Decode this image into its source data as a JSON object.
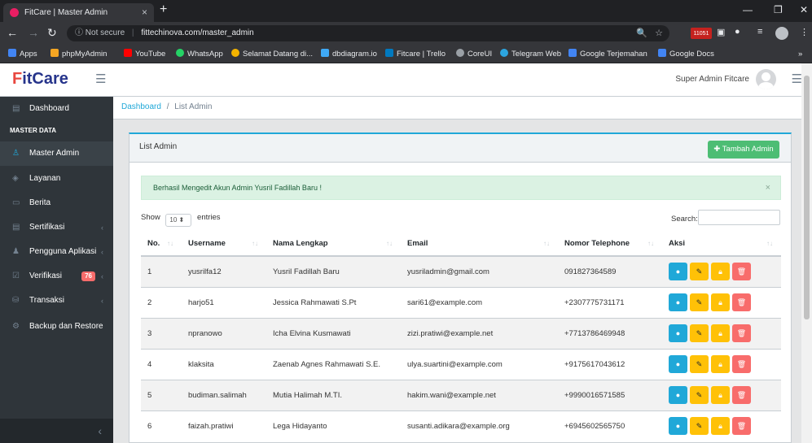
{
  "browser": {
    "tab_title": "FitCare | Master Admin",
    "tab_close": "×",
    "new_tab": "+",
    "not_secure": "Not secure",
    "url": "fittechinova.com/master_admin",
    "extension_badge": "11051",
    "bookmarks": [
      "Apps",
      "phpMyAdmin",
      "YouTube",
      "WhatsApp",
      "Selamat Datang di...",
      "dbdiagram.io",
      "Fitcare | Trello",
      "CoreUI",
      "Telegram Web",
      "Google Terjemahan",
      "Google Docs"
    ]
  },
  "header": {
    "logo_f": "F",
    "logo_rest": "itCare",
    "user_name": "Super Admin Fitcare"
  },
  "sidebar": {
    "dashboard": "Dashboard",
    "section_title": "MASTER DATA",
    "items": [
      {
        "label": "Master Admin"
      },
      {
        "label": "Layanan"
      },
      {
        "label": "Berita"
      },
      {
        "label": "Sertifikasi"
      },
      {
        "label": "Pengguna Aplikasi"
      },
      {
        "label": "Verifikasi",
        "badge": "76"
      },
      {
        "label": "Transaksi"
      },
      {
        "label": "Backup dan Restore"
      }
    ]
  },
  "breadcrumb": {
    "home": "Dashboard",
    "separator": "/",
    "current": "List Admin"
  },
  "card": {
    "title": "List Admin",
    "add_button": "Tambah Admin",
    "alert": "Berhasil Mengedit Akun Admin Yusril Fadillah Baru !",
    "show": "Show",
    "entries_value": "10",
    "entries": "entries",
    "search_label": "Search:"
  },
  "table": {
    "columns": [
      "No.",
      "Username",
      "Nama Lengkap",
      "Email",
      "Nomor Telephone",
      "Aksi"
    ],
    "rows": [
      {
        "no": "1",
        "username": "yusrilfa12",
        "nama": "Yusril Fadillah Baru",
        "email": "yusriladmin@gmail.com",
        "telephone": "091827364589"
      },
      {
        "no": "2",
        "username": "harjo51",
        "nama": "Jessica Rahmawati S.Pt",
        "email": "sari61@example.com",
        "telephone": "+2307775731171"
      },
      {
        "no": "3",
        "username": "npranowo",
        "nama": "Icha Elvina Kusmawati",
        "email": "zizi.pratiwi@example.net",
        "telephone": "+7713786469948"
      },
      {
        "no": "4",
        "username": "klaksita",
        "nama": "Zaenab Agnes Rahmawati S.E.",
        "email": "ulya.suartini@example.com",
        "telephone": "+9175617043612"
      },
      {
        "no": "5",
        "username": "budiman.salimah",
        "nama": "Mutia Halimah M.TI.",
        "email": "hakim.wani@example.net",
        "telephone": "+9990016571585"
      },
      {
        "no": "6",
        "username": "faizah.pratiwi",
        "nama": "Lega Hidayanto",
        "email": "susanti.adikara@example.org",
        "telephone": "+6945602565750"
      }
    ]
  },
  "colors": {
    "primary": "#20a8d8",
    "success": "#4dbd74",
    "warning": "#ffc107",
    "danger": "#f86c6b",
    "sidebar": "#2f353a"
  }
}
